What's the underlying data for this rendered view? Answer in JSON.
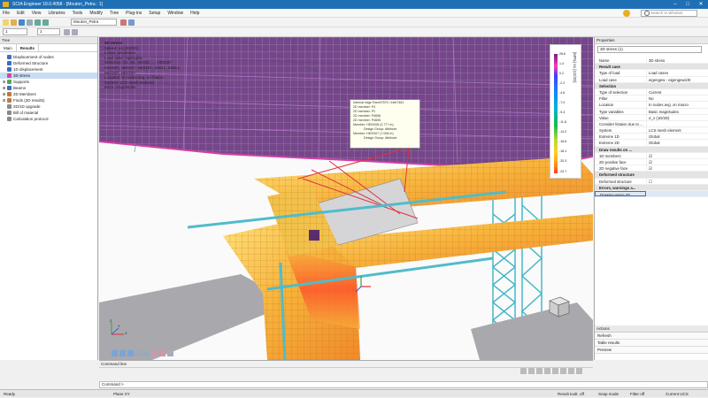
{
  "window": {
    "title": "SCIA Engineer 18.0.4058 - [Mouton_Petra : 1]",
    "minimize": "–",
    "maximize": "□",
    "close": "✕"
  },
  "menu": [
    "File",
    "Edit",
    "View",
    "Libraries",
    "Tools",
    "Modify",
    "Tree",
    "Plug-ins",
    "Setup",
    "Window",
    "Help"
  ],
  "search_placeholder": "Search in Window",
  "toolbar": {
    "zoom1": "1",
    "zoom2": "1",
    "project_combo": "Mouton_Petra"
  },
  "left_panel": {
    "title": "Tree",
    "tabs": [
      "Main",
      "Results"
    ],
    "items": [
      {
        "label": "Displacement of nodes",
        "color": "#3a6fc0",
        "indent": 0
      },
      {
        "label": "Deformed Structure",
        "color": "#3a6fc0",
        "indent": 0
      },
      {
        "label": "1D displacement",
        "color": "#3a6fc0",
        "indent": 0
      },
      {
        "label": "3D stress",
        "color": "#d04a9a",
        "indent": 0,
        "selected": true
      },
      {
        "label": "Supports",
        "color": "#5aa35a",
        "indent": 0
      },
      {
        "label": "Beams",
        "color": "#3a6fc0",
        "indent": 0
      },
      {
        "label": "2D Members",
        "color": "#c07a3a",
        "indent": 0
      },
      {
        "label": "Finds (2D results)",
        "color": "#c07a3a",
        "indent": 0
      },
      {
        "label": "2D/1D upgrade",
        "color": "#8a8a8a",
        "indent": 0
      },
      {
        "label": "Bill of material",
        "color": "#8a8a8a",
        "indent": 0
      },
      {
        "label": "Calculation protocol",
        "color": "#8a8a8a",
        "indent": 0
      }
    ]
  },
  "viewport": {
    "info_lines": [
      "3D stress",
      "Values: σx (2D/1D)",
      "Linear calculation",
      "Load case: eigengew",
      "Selection: S1, S6, HE018, ..., HE018?",
      "HE018?, HE018?, HE018?, S3611, S3612,",
      "HE018?, HE018?",
      "Location: In nodes avg. on macro.",
      "System: LCS mesh element",
      "Basic magnitudes"
    ],
    "tooltip_lines": [
      "Internal edge Ram07579 / Intel7481",
      "2D member: P4",
      "2D member: P2",
      "2D member: P4656",
      "2D member: P4655",
      "Member: HE0/008 (3.77? m)",
      "Design Group: Attribute",
      "Member: HE0/007 (7.008 m)",
      "Design Group: Attribute"
    ],
    "legend": {
      "unit": "[MPa] σx [1D/2D]",
      "ticks": [
        "28.6",
        "1.4",
        "0.2",
        "-2.2",
        "-4.6",
        "-7.0",
        "-9.4",
        "-11.8",
        "-14.2",
        "-16.6",
        "-18.1",
        "-20.3",
        "-23.7"
      ]
    },
    "axis_x": "X",
    "axis_y": "Y",
    "axis_z": "Z"
  },
  "right_panel": {
    "title": "Properties",
    "combo": "3D stress (1)",
    "rows": [
      {
        "section": false,
        "k": "Name",
        "v": "3D stress"
      },
      {
        "section": true,
        "k": "Result case"
      },
      {
        "section": false,
        "k": "Type of load",
        "v": "Load cases"
      },
      {
        "section": false,
        "k": "Load case",
        "v": "eigengew - eigengewicht"
      },
      {
        "section": true,
        "k": "Selection"
      },
      {
        "section": false,
        "k": "Type of selection",
        "v": "Current"
      },
      {
        "section": false,
        "k": "Filter",
        "v": "No"
      },
      {
        "section": false,
        "k": "Location",
        "v": "In nodes avg. on macro"
      },
      {
        "section": false,
        "k": "Type variables",
        "v": "Basic magnitudes"
      },
      {
        "section": false,
        "k": "Value",
        "v": "σ_x (1D/2D)"
      },
      {
        "section": false,
        "k": "Consider listaion due to ...",
        "v": ""
      },
      {
        "section": false,
        "k": "System",
        "v": "LCS mesh element"
      },
      {
        "section": false,
        "k": "Extreme 1D",
        "v": "Global"
      },
      {
        "section": false,
        "k": "Extreme 2D",
        "v": "Global"
      },
      {
        "section": true,
        "k": "Draw results on ..."
      },
      {
        "section": false,
        "k": "1D members",
        "v": "☑"
      },
      {
        "section": false,
        "k": "2D positive face",
        "v": "☑"
      },
      {
        "section": false,
        "k": "2D negative face",
        "v": "☑"
      },
      {
        "section": true,
        "k": "Deformed structure"
      },
      {
        "section": false,
        "k": "Deformed structure",
        "v": "☐"
      },
      {
        "section": true,
        "k": "Errors, warnings a..."
      },
      {
        "section": false,
        "k": "Drawing setup 2D",
        "v": ""
      }
    ],
    "actions_title": "Actions",
    "actions": [
      "Refresh",
      "Table results",
      "Preview"
    ]
  },
  "command": {
    "panel_title": "Command line",
    "prompt": "Command >"
  },
  "status": {
    "left": "Ready",
    "plane": "Plane XY",
    "right_items": [
      "Result toolt. off",
      "Snap mode",
      "Filter off",
      "Current UCS"
    ]
  },
  "colors": {
    "titlebar": "#1f6fb6",
    "selection": "#c8dcf4",
    "structure_cyan": "#5ec8d6",
    "shell_orange": "#f4a63a",
    "slab_purple": "#5a2d6e"
  }
}
